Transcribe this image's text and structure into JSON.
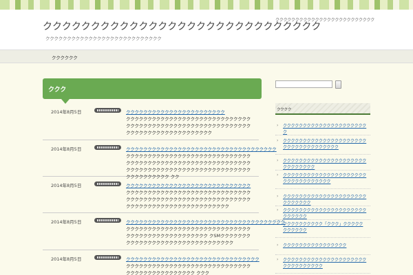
{
  "header": {
    "site_title": "ククククククククククククククククククククククククククククク",
    "site_desc": "ククククククククククククククククククククククククククク",
    "note": "ククククククククククククククククククククククククク"
  },
  "nav": {
    "home": "クククククク"
  },
  "main": {
    "heading": "ククク",
    "posts": [
      {
        "date": "2014年8月5日",
        "title": "ククククククククククククククククククククククク",
        "excerpt": "クククククククククククククククククククククククククククククククククククククククククククククククククククククククククククククククククククククククククククククク"
      },
      {
        "date": "2014年8月5日",
        "title": "ククククククククククククククククククククククククククククククククククク",
        "excerpt": "ククククククククククククククククククククククククククククククククククククククククククククククククククククククククククククククククククククククククククククククククククククククククククククククククク クク"
      },
      {
        "date": "2014年8月5日",
        "title": "ククククククククククククククククククククククククククククク",
        "excerpt": "クククククククククククククククククククククククククククククククククククククククククククククククククククククククククククククククククククククククククククククククククク"
      },
      {
        "date": "2014年8月5日",
        "title": "ククククククククククククククククククククククククククククククククククククク",
        "excerpt": "クククククククククククククククククククククククククククククククククククククククククククククククク クSMクククククククククククククククククククククククククククククククク"
      },
      {
        "date": "2014年8月5日",
        "title": "ククククククククククククククククククククククククククククククク",
        "excerpt": "ククククククククククククククククククククククククククククククククククククククククククククク ククク"
      }
    ]
  },
  "sidebar": {
    "search": {
      "placeholder": ""
    },
    "widget_title": "クククク",
    "items": [
      "クククククククククククククククククククククク",
      "ククククククククククククククククククククククククククククククククククク",
      "ククククククククククククククククククククククククククククク",
      "ククククククククククククククククククククククククククククククククク",
      "クククククククククククククククククククククククククククク",
      "ククククククククククククククククククククククククククク",
      "クククククククククク「ククク」ククククククククククク",
      "クククククククククククククククク",
      "ククククククククククククククククククククククククククククククク"
    ]
  }
}
